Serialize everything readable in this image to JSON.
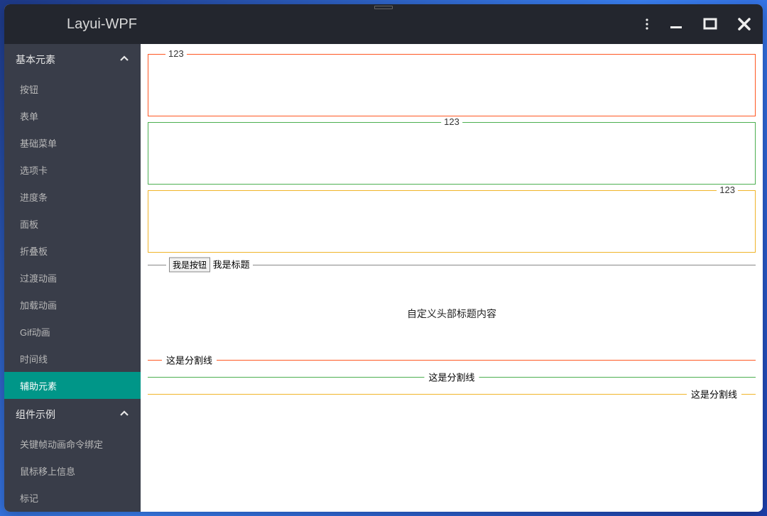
{
  "app": {
    "title": "Layui-WPF"
  },
  "sidebar": {
    "group1": {
      "title": "基本元素",
      "items": [
        {
          "label": "按钮"
        },
        {
          "label": "表单"
        },
        {
          "label": "基础菜单"
        },
        {
          "label": "选项卡"
        },
        {
          "label": "进度条"
        },
        {
          "label": "面板"
        },
        {
          "label": "折叠板"
        },
        {
          "label": "过渡动画"
        },
        {
          "label": "加载动画"
        },
        {
          "label": "Gif动画"
        },
        {
          "label": "时间线"
        },
        {
          "label": "辅助元素"
        }
      ]
    },
    "group2": {
      "title": "组件示例",
      "items": [
        {
          "label": "关键帧动画命令绑定"
        },
        {
          "label": "鼠标移上信息"
        },
        {
          "label": "标记"
        }
      ]
    }
  },
  "main": {
    "fieldsets": [
      {
        "legend": "123",
        "pos": "left",
        "color": "red"
      },
      {
        "legend": "123",
        "pos": "center",
        "color": "green"
      },
      {
        "legend": "123",
        "pos": "right",
        "color": "yellow"
      }
    ],
    "inline_button": "我是按钮",
    "inline_title": "我是标题",
    "custom_header": "自定义头部标题内容",
    "dividers": [
      {
        "text": "这是分割线",
        "pos": "left",
        "color": "red"
      },
      {
        "text": "这是分割线",
        "pos": "center",
        "color": "green"
      },
      {
        "text": "这是分割线",
        "pos": "right",
        "color": "yellow"
      }
    ]
  },
  "colors": {
    "teal": "#009688",
    "sidebar_bg": "#393d49",
    "titlebar_bg": "#23262e"
  }
}
